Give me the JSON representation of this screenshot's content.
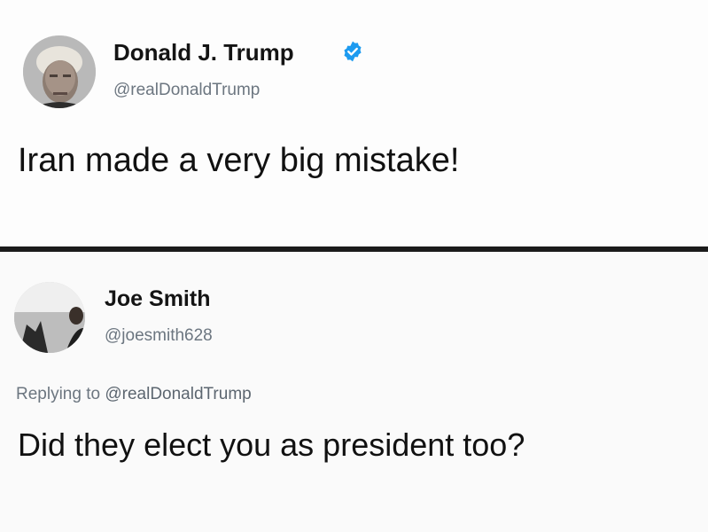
{
  "tweets": [
    {
      "display_name": "Donald J. Trump",
      "handle": "@realDonaldTrump",
      "verified": true,
      "text": "Iran made a very big mistake!"
    },
    {
      "display_name": "Joe Smith",
      "handle": "@joesmith628",
      "replying_prefix": "Replying to",
      "replying_to": "@realDonaldTrump",
      "text": "Did they elect you as president too?"
    }
  ],
  "colors": {
    "verified_badge": "#1d9bf0",
    "handle_text": "#6c7680",
    "divider": "#1b1b1b"
  },
  "icons": {
    "verified": "verified-badge-icon"
  }
}
